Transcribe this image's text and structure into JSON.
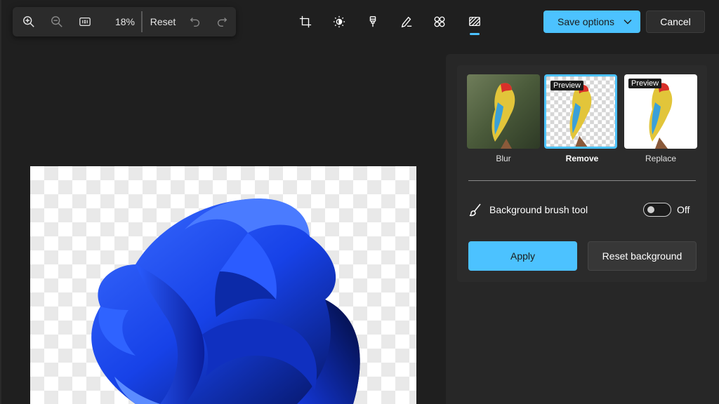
{
  "zoom_toolbar": {
    "zoom_in_icon": "zoom-in-icon",
    "zoom_out_icon": "zoom-out-icon",
    "actual_size_icon": "actual-size-icon",
    "zoom_level": "18%",
    "reset_label": "Reset",
    "undo_icon": "undo-icon",
    "redo_icon": "redo-icon"
  },
  "tools": [
    {
      "name": "crop",
      "icon": "crop-icon"
    },
    {
      "name": "adjust",
      "icon": "brightness-icon"
    },
    {
      "name": "retouch",
      "icon": "retouch-brush-icon"
    },
    {
      "name": "markup",
      "icon": "markup-pen-icon"
    },
    {
      "name": "filters",
      "icon": "filter-icon"
    },
    {
      "name": "background",
      "icon": "background-icon",
      "active": true
    }
  ],
  "actions": {
    "save_label": "Save options",
    "cancel_label": "Cancel"
  },
  "background_panel": {
    "options": [
      {
        "label": "Blur",
        "badge": "",
        "selected": false
      },
      {
        "label": "Remove",
        "badge": "Preview",
        "selected": true
      },
      {
        "label": "Replace",
        "badge": "Preview",
        "selected": false
      }
    ],
    "brush_label": "Background brush tool",
    "brush_toggle": {
      "state": "Off",
      "on": false
    },
    "apply_label": "Apply",
    "reset_bg_label": "Reset background"
  },
  "colors": {
    "accent": "#4cc2ff",
    "background": "#1f1f1f",
    "panel": "#272727",
    "card": "#2b2b2b"
  }
}
